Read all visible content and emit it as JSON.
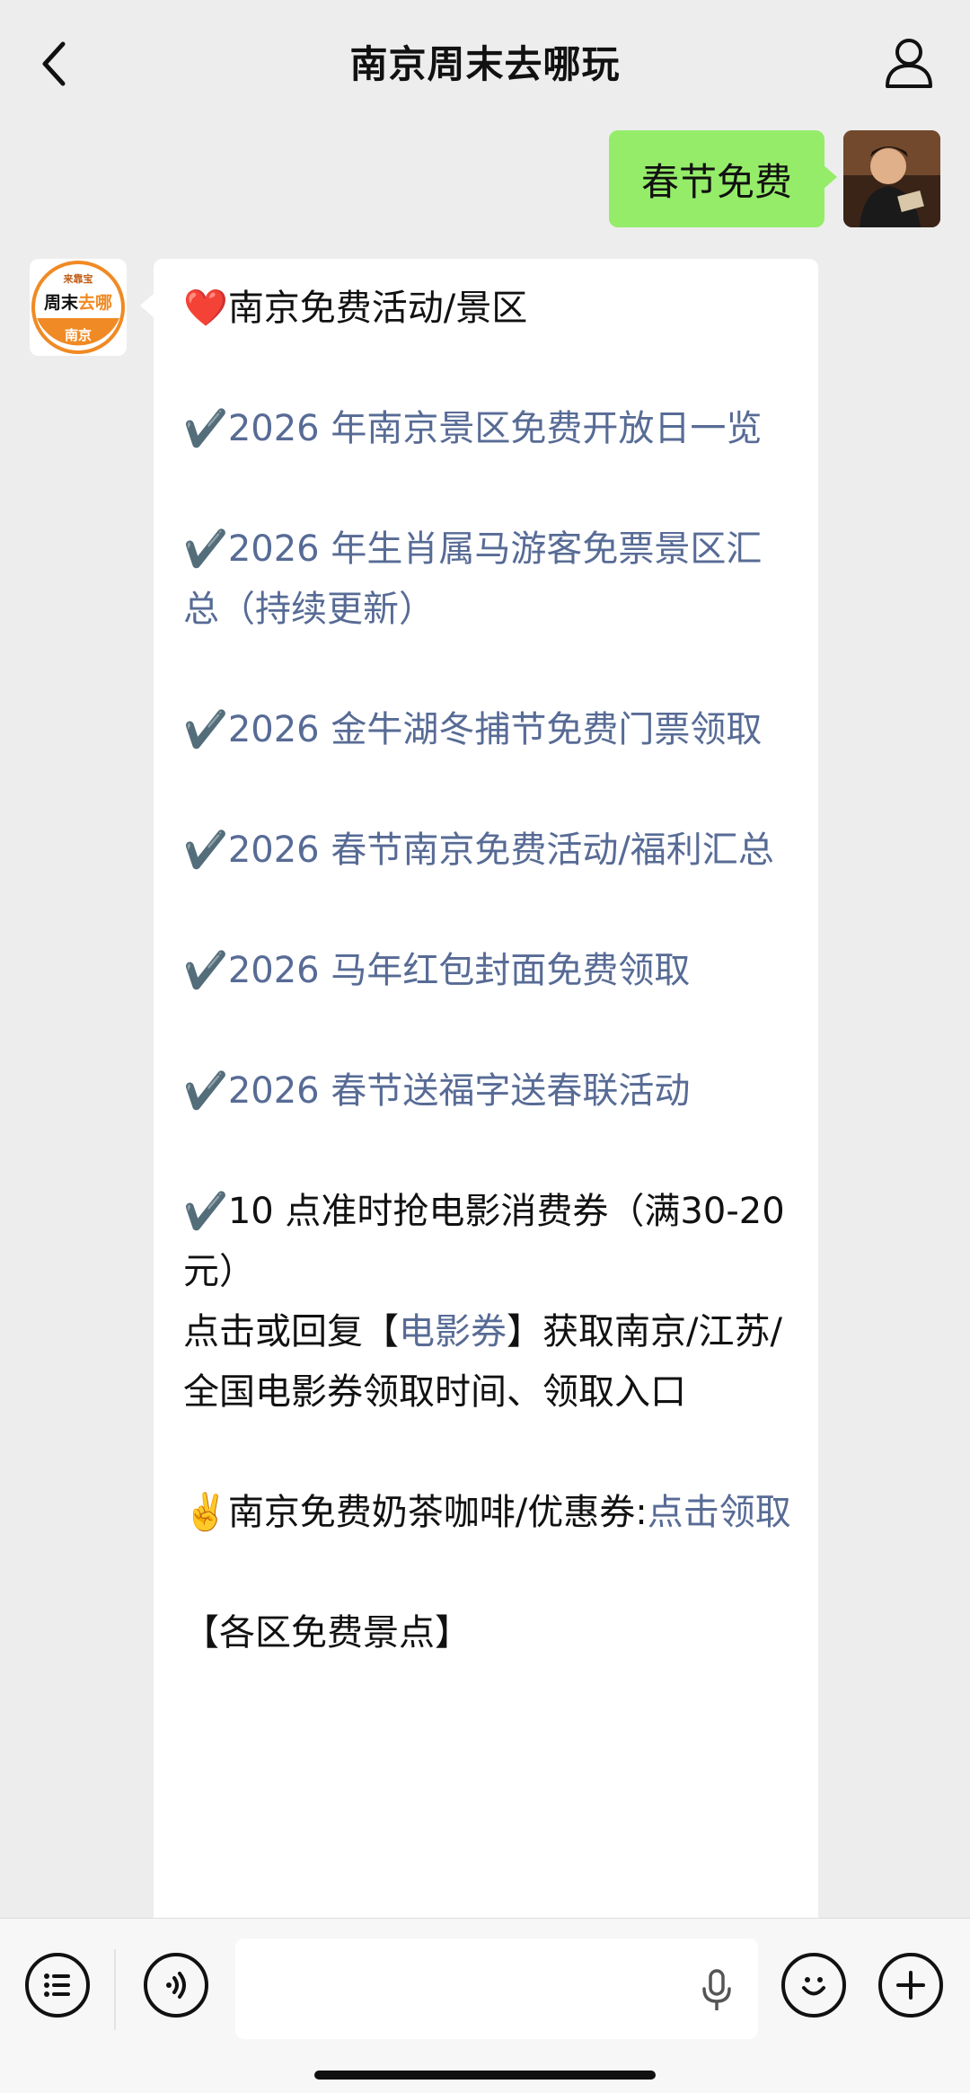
{
  "header": {
    "title": "南京周末去哪玩"
  },
  "outgoing": {
    "text": "春节免费"
  },
  "bot_avatar": {
    "top_text": "来靠宝",
    "mid_text_a": "周末",
    "mid_text_b": "去哪",
    "bottom_text": "南京"
  },
  "message": {
    "heading_emoji": "❤️",
    "heading": "南京免费活动/景区",
    "check": "✔️",
    "items": [
      "2026 年南京景区免费开放日一览",
      "2026 年生肖属马游客免票景区汇总（持续更新）",
      "2026 金牛湖冬捕节免费门票领取",
      "2026 春节南京免费活动/福利汇总",
      "2026 马年红包封面免费领取",
      "2026 春节送福字送春联活动"
    ],
    "coupon_line": "10 点准时抢电影消费券（满30-20 元）",
    "reply_prefix": "点击或回复【",
    "reply_keyword": "电影券",
    "reply_suffix": "】获取南京/江苏/全国电影券领取时间、领取入口",
    "milk_emoji": "✌️",
    "milk_text": "南京免费奶茶咖啡/优惠券:",
    "milk_link": "点击领取",
    "partial_next": "【各区免费景点】"
  }
}
